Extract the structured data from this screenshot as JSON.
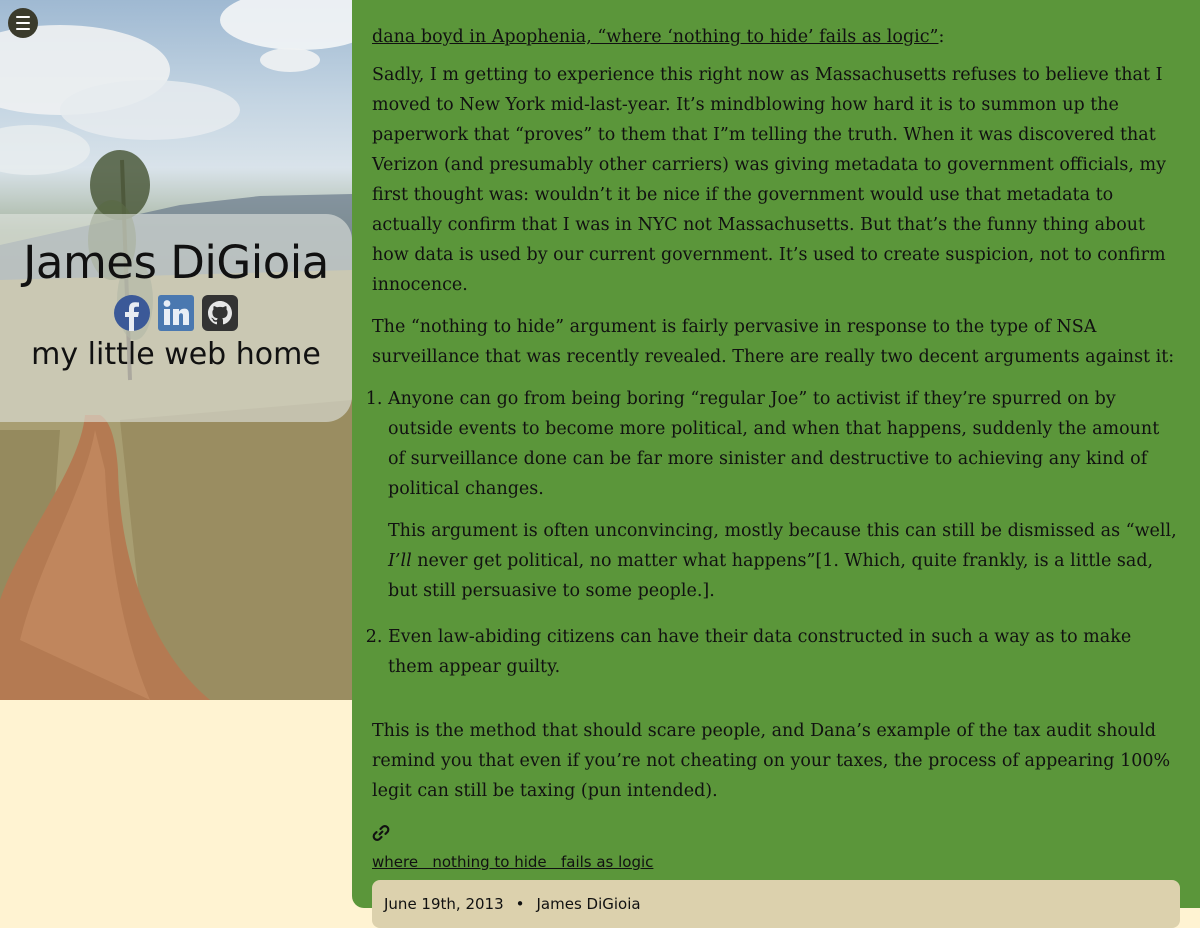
{
  "nav": {
    "menu_icon": "hamburger-menu-icon"
  },
  "site": {
    "name": "James DiGioia",
    "tagline": "my little web home",
    "socials": [
      {
        "name": "facebook-icon",
        "color": "#3b5998"
      },
      {
        "name": "linkedin-icon",
        "color": "#4a78b0"
      },
      {
        "name": "github-icon",
        "color": "#333333"
      }
    ]
  },
  "colors": {
    "page_bg": "#fff3d2",
    "card_bg": "#5b963a",
    "meta_bg": "#dcd1ad"
  },
  "article": {
    "source_link": "dana boyd in Apophenia, “where ‘nothing to hide’ fails as logic”",
    "source_colon": ":",
    "para1": "Sadly, I  m getting to experience this right now as Massachusetts refuses to believe that I moved to New York mid-last-year. It’s mindblowing how hard it is to summon up the paperwork that “proves” to them that I”m telling the truth. When it was discovered that Verizon (and presumably other carriers) was giving metadata to government officials, my first thought was: wouldn’t it be nice if the government would use that metadata to actually confirm that I was in NYC not Massachusetts. But that’s the funny thing about how data is used by our current government. It’s used to create suspicion, not to confirm innocence.",
    "para2": "The “nothing to hide” argument is fairly pervasive in response to the type of NSA surveillance that was recently revealed. There are really two decent arguments against it:",
    "list": [
      {
        "text": "Anyone can go from being boring “regular Joe” to activist if they’re spurred on by outside events to become more political, and when that happens, suddenly the amount of surveillance done can be far more sinister and destructive to achieving any kind of political changes.",
        "sub_before": "This argument is often unconvincing, mostly because this can still be dismissed as “well, ",
        "sub_em": "I’ll",
        "sub_after": " never get political, no matter what happens”[1. Which, quite frankly, is a little sad, but still persuasive to some people.]."
      },
      {
        "text": "Even law-abiding citizens can have their data constructed in such a way as to make them appear guilty."
      }
    ],
    "para3": "This is the method that should scare people, and Dana’s example of the tax audit should remind you that even if you’re not cheating on your taxes, the process of appearing 100% legit can still be taxing (pun intended).",
    "permalink_icon": "link-icon",
    "permalink_text": "where   nothing to hide   fails as logic",
    "date": "June 19th, 2013",
    "separator": "•",
    "author": "James DiGioia"
  }
}
